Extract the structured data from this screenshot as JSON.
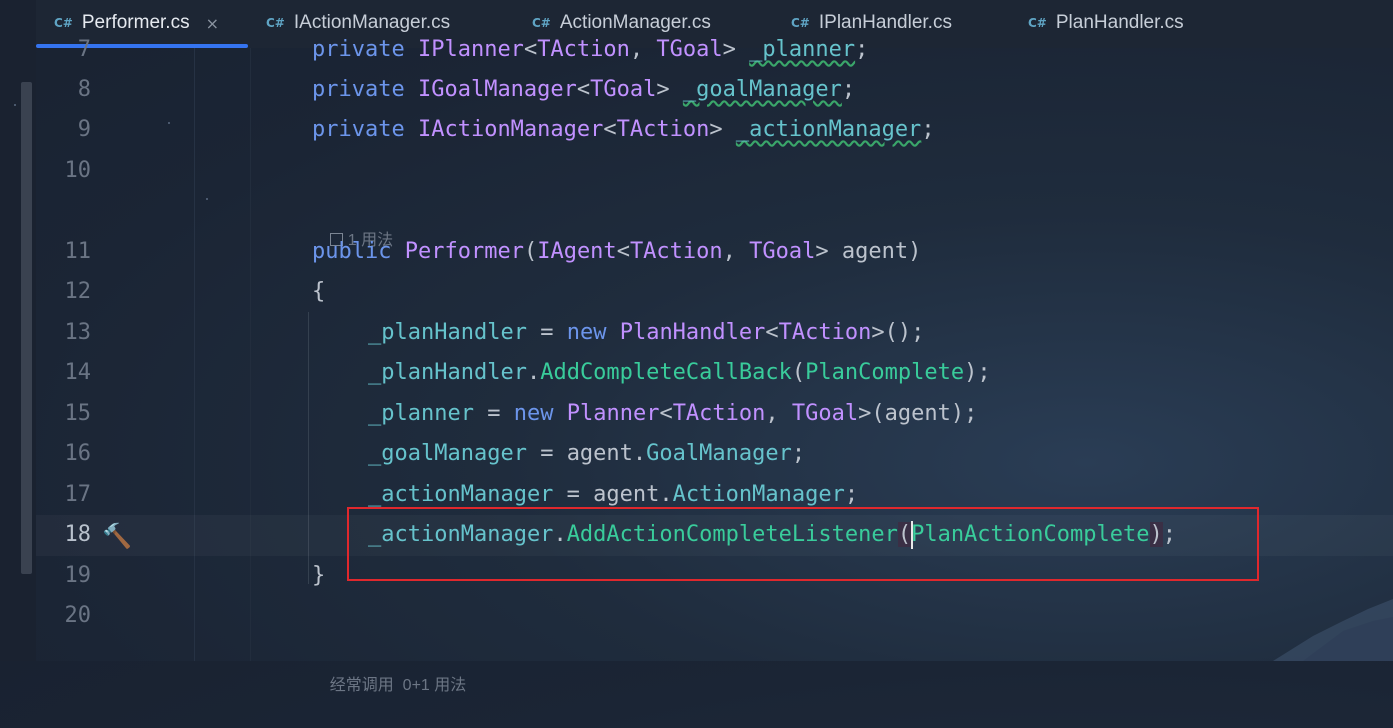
{
  "tabs": [
    {
      "lang": "C#",
      "label": "Performer.cs",
      "active": true,
      "close": "×"
    },
    {
      "lang": "C#",
      "label": "IActionManager.cs"
    },
    {
      "lang": "C#",
      "label": "ActionManager.cs"
    },
    {
      "lang": "C#",
      "label": "IPlanHandler.cs"
    },
    {
      "lang": "C#",
      "label": "PlanHandler.cs"
    }
  ],
  "lines": [
    {
      "num": "7",
      "code": "private IPlanner<TAction, TGoal> _planner;"
    },
    {
      "num": "8",
      "code": "private IGoalManager<TGoal> _goalManager;"
    },
    {
      "num": "9",
      "code": "private IActionManager<TAction> _actionManager;"
    },
    {
      "num": "10",
      "code": ""
    },
    {
      "num": "11",
      "code": "public Performer(IAgent<TAction, TGoal> agent)"
    },
    {
      "num": "12",
      "code": "{"
    },
    {
      "num": "13",
      "code": "_planHandler = new PlanHandler<TAction>();"
    },
    {
      "num": "14",
      "code": "_planHandler.AddCompleteCallBack(PlanComplete);"
    },
    {
      "num": "15",
      "code": "_planner = new Planner<TAction, TGoal>(agent);"
    },
    {
      "num": "16",
      "code": "_goalManager = agent.GoalManager;"
    },
    {
      "num": "17",
      "code": "_actionManager = agent.ActionManager;"
    },
    {
      "num": "18",
      "code": "_actionManager.AddActionCompleteListener(PlanActionComplete);"
    },
    {
      "num": "19",
      "code": "}"
    },
    {
      "num": "20",
      "code": ""
    }
  ],
  "hints": {
    "usages_1": "1 用法",
    "bottom": "经常调用  0+1 用法"
  },
  "gutter_icon": "hammer-icon",
  "colors": {
    "keyword": "#6c95eb",
    "type": "#c191ff",
    "field": "#66c3cc",
    "method": "#39cc9b",
    "highlight_box": "#e0282d",
    "tab_underline": "#3574f0"
  }
}
